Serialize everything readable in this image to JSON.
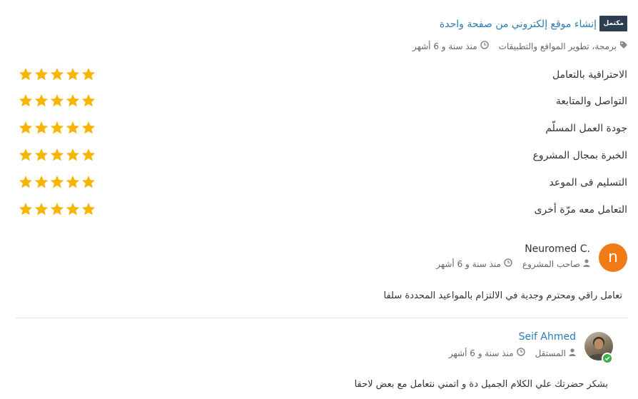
{
  "project": {
    "status_badge": "مكتمل",
    "title": "إنشاء موقع إلكتروني من صفحة واحدة",
    "category": "برمجة، تطوير المواقع والتطبيقات",
    "time_ago": "منذ سنة و 6 أشهر",
    "icons": {
      "category": "tag-icon",
      "time": "clock-icon"
    }
  },
  "ratings": [
    {
      "label": "الاحترافية بالتعامل",
      "stars": 5,
      "max": 5
    },
    {
      "label": "التواصل والمتابعة",
      "stars": 5,
      "max": 5
    },
    {
      "label": "جودة العمل المسلّم",
      "stars": 5,
      "max": 5
    },
    {
      "label": "الخبرة بمجال المشروع",
      "stars": 5,
      "max": 5
    },
    {
      "label": "التسليم فى الموعد",
      "stars": 5,
      "max": 5
    },
    {
      "label": "التعامل معه مرّة أخرى",
      "stars": 5,
      "max": 5
    }
  ],
  "reviews": [
    {
      "avatar_letter": "n",
      "name": "Neuromed C.",
      "role": "صاحب المشروع",
      "time_ago": "منذ سنة و 6 أشهر",
      "text": "تعامل راقي ومحترم وجدية في الالتزام بالمواعيد المحددة سلفا"
    },
    {
      "name": "Seif Ahmed",
      "role": "المستقل",
      "time_ago": "منذ سنة و 6 أشهر",
      "text": "بشكر حضرتك علي الكلام الجميل دة و اتمني نتعامل مع بعض لاحقا"
    }
  ],
  "colors": {
    "star": "#f7b500",
    "link": "#2c7bb6",
    "badge_bg": "#2d3e50",
    "avatar_orange": "#ef7a16",
    "online": "#3cb04a"
  }
}
